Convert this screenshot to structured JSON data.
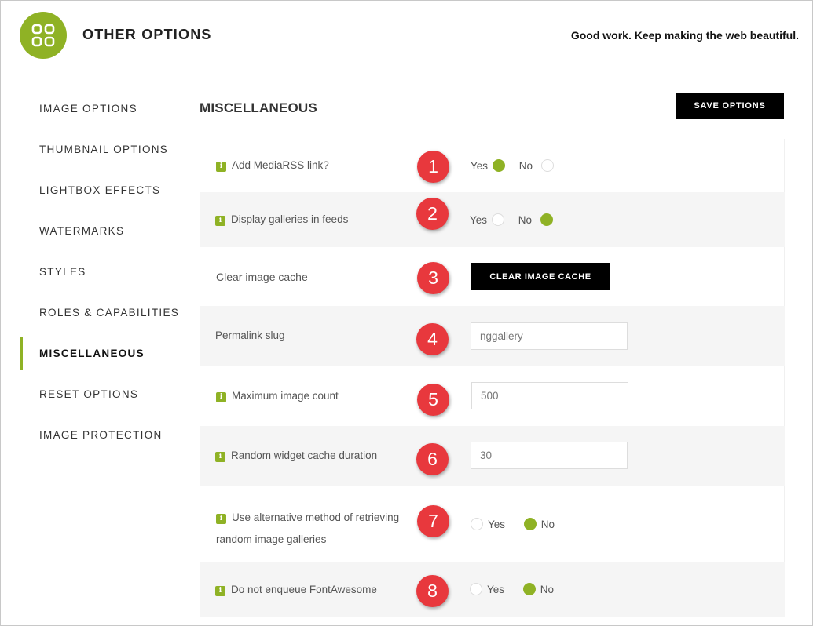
{
  "header": {
    "title": "OTHER OPTIONS",
    "tagline": "Good work. Keep making the web beautiful.",
    "logo_icon": "grid-icon",
    "accent_color": "#8fb225"
  },
  "sidebar": {
    "items": [
      {
        "label": "IMAGE OPTIONS"
      },
      {
        "label": "THUMBNAIL OPTIONS"
      },
      {
        "label": "LIGHTBOX EFFECTS"
      },
      {
        "label": "WATERMARKS"
      },
      {
        "label": "STYLES"
      },
      {
        "label": "ROLES & CAPABILITIES"
      },
      {
        "label": "MISCELLANEOUS",
        "active": true
      },
      {
        "label": "RESET OPTIONS"
      },
      {
        "label": "IMAGE PROTECTION"
      }
    ]
  },
  "main": {
    "title": "MISCELLANEOUS",
    "save_label": "SAVE OPTIONS",
    "rows": [
      {
        "badge": "1",
        "label": "Add MediaRSS link?",
        "yes": "Yes",
        "no": "No",
        "selected": "yes"
      },
      {
        "badge": "2",
        "label": "Display galleries in feeds",
        "yes": "Yes",
        "no": "No",
        "selected": "no"
      },
      {
        "badge": "3",
        "label": "Clear image cache",
        "button": "CLEAR IMAGE CACHE"
      },
      {
        "badge": "4",
        "label": "Permalink slug",
        "value": "nggallery"
      },
      {
        "badge": "5",
        "label": "Maximum image count",
        "value": "500"
      },
      {
        "badge": "6",
        "label": "Random widget cache duration",
        "value": "30"
      },
      {
        "badge": "7",
        "label_line1": "Use alternative method of retrieving",
        "label_line2": "random image galleries",
        "yes": "Yes",
        "no": "No",
        "selected": "no"
      },
      {
        "badge": "8",
        "label": "Do not enqueue FontAwesome",
        "yes": "Yes",
        "no": "No",
        "selected": "no"
      }
    ],
    "info_glyph": "i",
    "badge_color": "#e8383d"
  }
}
